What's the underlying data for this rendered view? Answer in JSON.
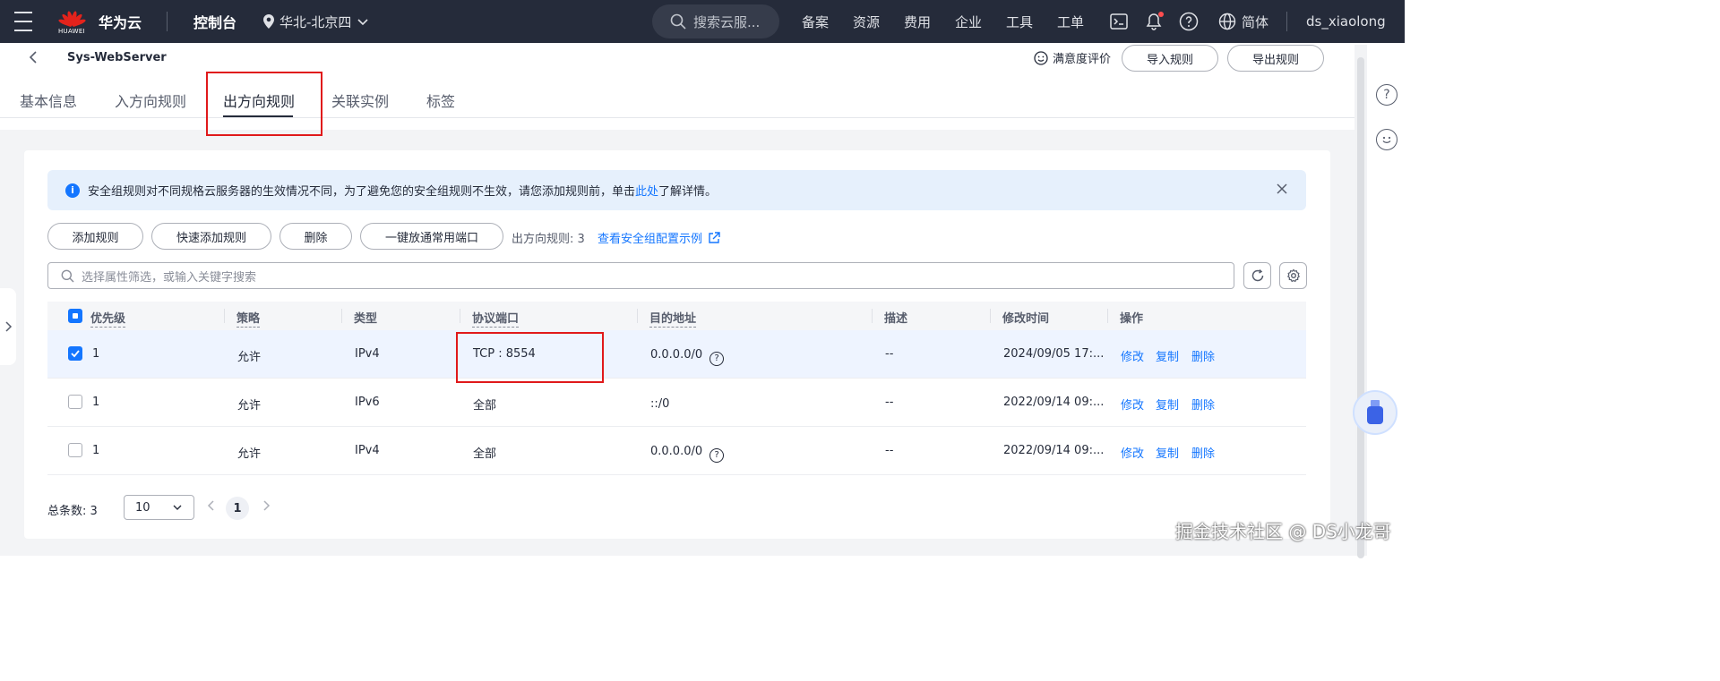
{
  "topbar": {
    "logo_text": "HUAWEI",
    "brand": "华为云",
    "console": "控制台",
    "region": "华北-北京四",
    "search_placeholder": "搜索云服...",
    "nav": [
      "备案",
      "资源",
      "费用",
      "企业",
      "工具",
      "工单"
    ],
    "lang": "简体",
    "user": "ds_xiaolong"
  },
  "header": {
    "title": "Sys-WebServer",
    "satisfaction": "满意度评价",
    "import_label": "导入规则",
    "export_label": "导出规则"
  },
  "tabs": [
    "基本信息",
    "入方向规则",
    "出方向规则",
    "关联实例",
    "标签"
  ],
  "active_tab": "出方向规则",
  "alert": {
    "text_before": "安全组规则对不同规格云服务器的生效情况不同，为了避免您的安全组规则不生效，请您添加规则前，单击",
    "link": "此处",
    "text_after": "了解详情。"
  },
  "toolbar": {
    "add": "添加规则",
    "quick_add": "快速添加规则",
    "delete": "删除",
    "one_click": "一键放通常用端口",
    "count_text": "出方向规则: 3",
    "example_link": "查看安全组配置示例"
  },
  "filter": {
    "placeholder": "选择属性筛选，或输入关键字搜索"
  },
  "table": {
    "headers": [
      "优先级",
      "策略",
      "类型",
      "协议端口",
      "目的地址",
      "描述",
      "修改时间",
      "操作"
    ],
    "rows": [
      {
        "priority": "1",
        "policy": "允许",
        "type": "IPv4",
        "port": "TCP : 8554",
        "dest": "0.0.0.0/0",
        "desc": "--",
        "time": "2024/09/05 17:...",
        "checked": true,
        "help": true
      },
      {
        "priority": "1",
        "policy": "允许",
        "type": "IPv6",
        "port": "全部",
        "dest": "::/0",
        "desc": "--",
        "time": "2022/09/14 09:...",
        "checked": false,
        "help": false
      },
      {
        "priority": "1",
        "policy": "允许",
        "type": "IPv4",
        "port": "全部",
        "dest": "0.0.0.0/0",
        "desc": "--",
        "time": "2022/09/14 09:...",
        "checked": false,
        "help": true
      }
    ],
    "actions": [
      "修改",
      "复制",
      "删除"
    ]
  },
  "pagination": {
    "total": "总条数: 3",
    "page_size": "10",
    "current": "1"
  },
  "watermark": "掘金技术社区 @ DS小龙哥",
  "colors": {
    "topbar": "#252b3a",
    "link": "#1476ff",
    "highlight": "#e0191b",
    "alert_bg": "#e6f0fc"
  }
}
